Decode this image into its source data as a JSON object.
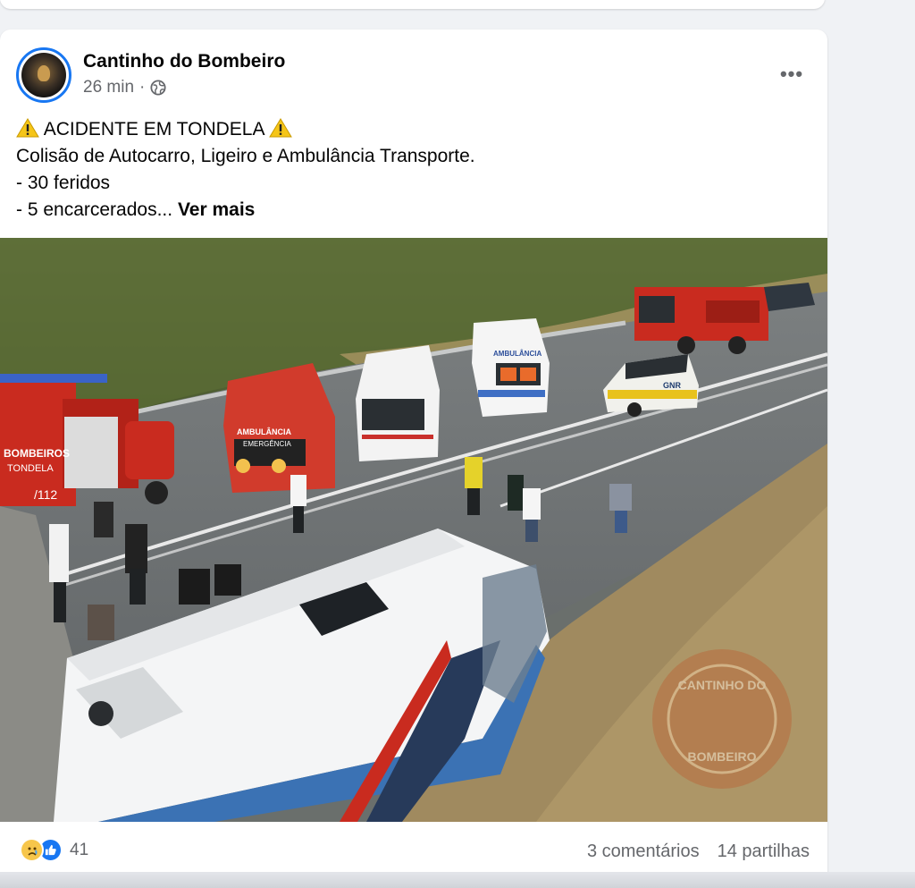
{
  "post": {
    "page_name": "Cantinho do Bombeiro",
    "time": "26 min",
    "separator": "·",
    "audience_icon": "globe-icon",
    "more_icon": "more-options-icon",
    "more_label": "•••",
    "lines": {
      "headline": "ACIDENTE EM TONDELA",
      "line2": "Colisão de Autocarro, Ligeiro e Ambulância Transporte.",
      "line3": "- 30 feridos",
      "line4": "- 5 encarcerados..."
    },
    "see_more": "Ver mais"
  },
  "photo": {
    "watermark_text": "CANTINHO DO BOMBEIRO",
    "truck_text": "BOMBEIROS TONDELA",
    "truck_number": "112",
    "ambulance_text": "AMBULÂNCIA EMERGÊNCIA",
    "ambulance2_text": "AMBULÂNCIA",
    "police_text": "GNR"
  },
  "footer": {
    "reactions": [
      "sad-reaction-icon",
      "like-reaction-icon"
    ],
    "reaction_count": "41",
    "comments": "3 comentários",
    "shares": "14 partilhas"
  },
  "colors": {
    "facebook_blue": "#1877f2",
    "text_secondary": "#65676b"
  }
}
